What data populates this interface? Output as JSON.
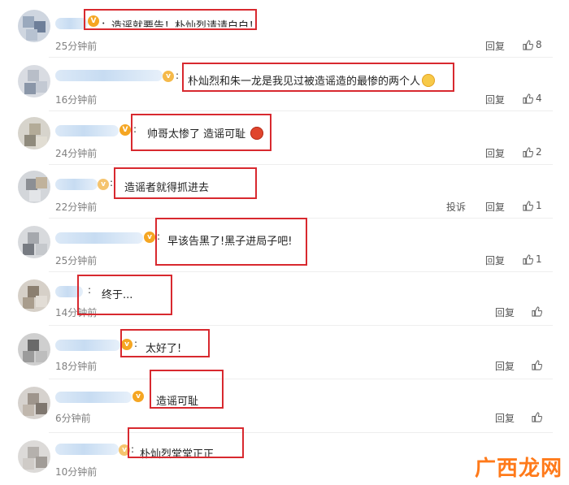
{
  "comments": [
    {
      "text": "：造谣就要告！朴灿烈请请白白！",
      "time": "25分钟前",
      "reply": "回复",
      "likes": "8"
    },
    {
      "text": "朴灿烈和朱一龙是我见过被造谣造的最惨的两个人",
      "time": "16分钟前",
      "reply": "回复",
      "likes": "4"
    },
    {
      "text": "帅哥太惨了 造谣可耻",
      "time": "24分钟前",
      "reply": "回复",
      "likes": "2"
    },
    {
      "text": "造谣者就得抓进去",
      "time": "22分钟前",
      "report": "投诉",
      "reply": "回复",
      "likes": "1"
    },
    {
      "text": "早该告黑了!黑子进局子吧!",
      "time": "25分钟前",
      "reply": "回复",
      "likes": "1"
    },
    {
      "text": "终于...",
      "time": "14分钟前",
      "reply": "回复"
    },
    {
      "text": "太好了!",
      "time": "18分钟前",
      "reply": "回复"
    },
    {
      "text": "造谣可耻",
      "time": "6分钟前",
      "reply": "回复"
    },
    {
      "text": "朴灿烈堂堂正正",
      "time": "10分钟前",
      "reply": "回复"
    }
  ],
  "watermark": "广西龙网",
  "colors": {
    "highlight_box": "#d8292f",
    "watermark": "#ff7a1a",
    "name_blur": "#c7dcf2"
  },
  "icons": {
    "like": "thumbs-up-icon",
    "vip_badge": "vip-badge-icon",
    "emoji": "emoji-icon"
  }
}
